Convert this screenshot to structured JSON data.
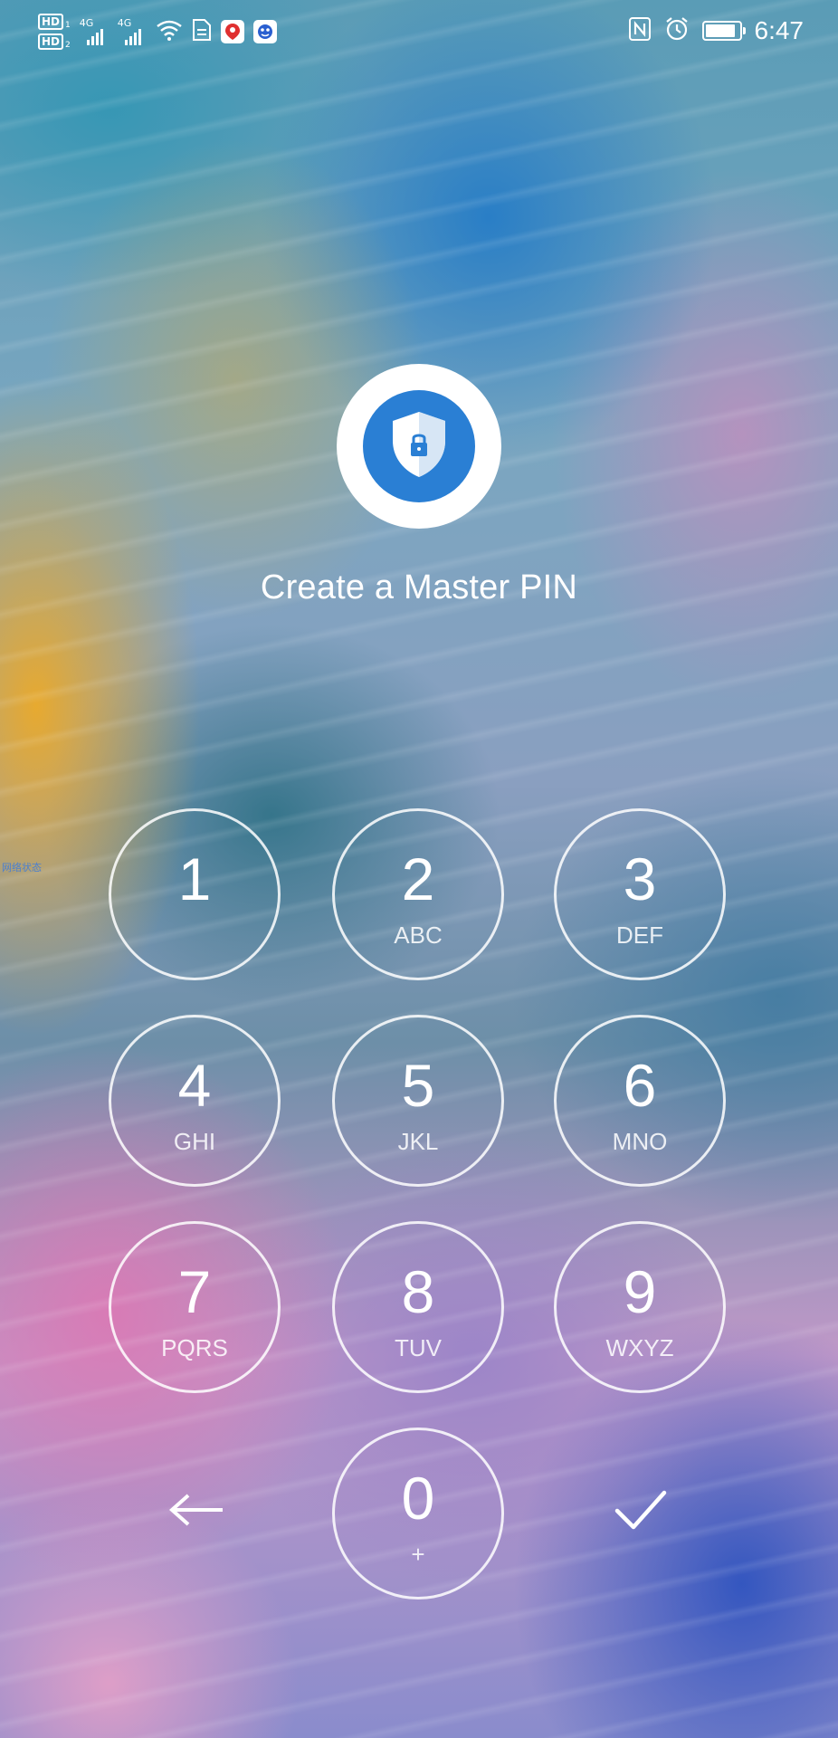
{
  "status_bar": {
    "sim1_label": "HD",
    "sim1_index": "1",
    "sim2_label": "HD",
    "sim2_index": "2",
    "network1": "4G",
    "network2": "4G",
    "time": "6:47",
    "battery_level_percent": 90
  },
  "side_label": "网络状态",
  "app": {
    "logo_icon": "shield-lock-icon",
    "title": "Create a Master PIN",
    "accent_color": "#2a7fd4"
  },
  "keypad": {
    "keys": [
      {
        "digit": "1",
        "letters": ""
      },
      {
        "digit": "2",
        "letters": "ABC"
      },
      {
        "digit": "3",
        "letters": "DEF"
      },
      {
        "digit": "4",
        "letters": "GHI"
      },
      {
        "digit": "5",
        "letters": "JKL"
      },
      {
        "digit": "6",
        "letters": "MNO"
      },
      {
        "digit": "7",
        "letters": "PQRS"
      },
      {
        "digit": "8",
        "letters": "TUV"
      },
      {
        "digit": "9",
        "letters": "WXYZ"
      },
      {
        "digit": "0",
        "letters": "+"
      }
    ],
    "back_icon": "arrow-left-icon",
    "confirm_icon": "checkmark-icon"
  }
}
